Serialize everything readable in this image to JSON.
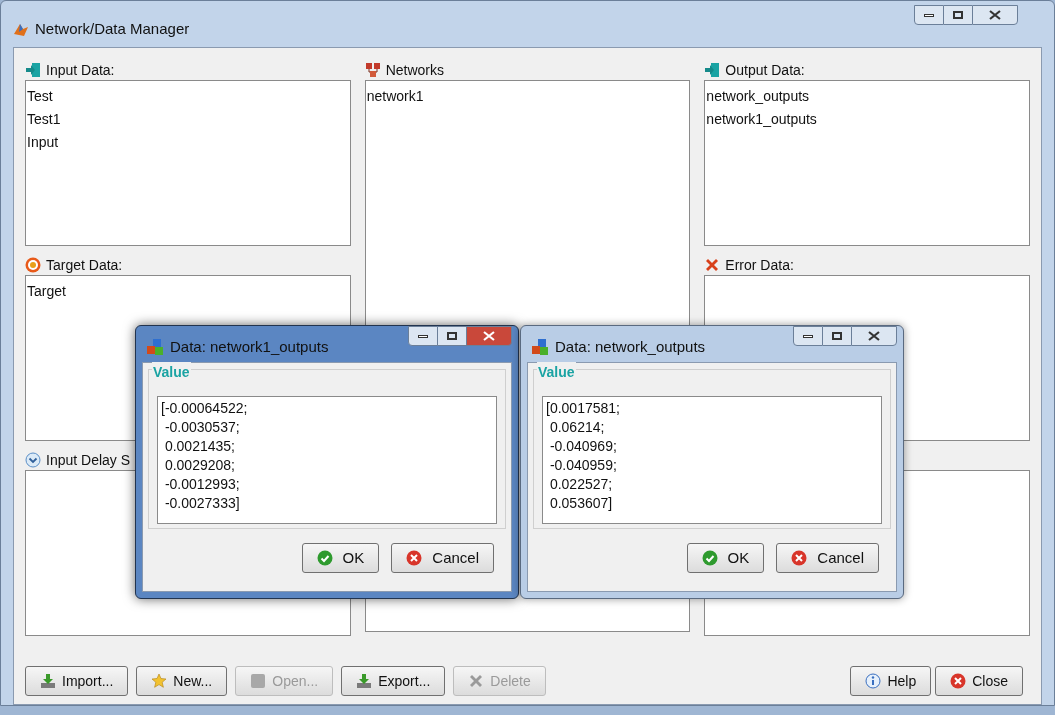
{
  "window": {
    "title": "Network/Data Manager"
  },
  "columns": [
    [
      {
        "label": "Input Data:",
        "kind": "input",
        "items": [
          "Test",
          "Test1",
          "Input"
        ]
      },
      {
        "label": "Target Data:",
        "kind": "target",
        "items": [
          "Target"
        ]
      },
      {
        "label": "Input Delay S",
        "kind": "delay"
      }
    ],
    [
      {
        "label": "Networks",
        "kind": "network",
        "items": [
          "network1"
        ]
      }
    ],
    [
      {
        "label": "Output Data:",
        "kind": "output",
        "items": [
          "network_outputs",
          "network1_outputs"
        ]
      },
      {
        "label": "Error Data:",
        "kind": "error"
      },
      {
        "kind": "plain"
      }
    ]
  ],
  "buttons_left": [
    {
      "label": "Import...",
      "kind": "import",
      "disabled": false
    },
    {
      "label": "New...",
      "kind": "new",
      "disabled": false
    },
    {
      "label": "Open...",
      "kind": "open",
      "disabled": true
    },
    {
      "label": "Export...",
      "kind": "export",
      "disabled": false
    },
    {
      "label": "Delete",
      "kind": "delete",
      "disabled": true
    }
  ],
  "buttons_right": [
    {
      "label": "Help",
      "kind": "help",
      "disabled": false
    },
    {
      "label": "Close",
      "kind": "close",
      "disabled": false
    }
  ],
  "dialogs": [
    {
      "title": "Data: network1_outputs",
      "active": true,
      "group_label": "Value",
      "value_lines": [
        "[-0.00064522;",
        " -0.0030537;",
        " 0.0021435;",
        " 0.0029208;",
        " -0.0012993;",
        " -0.0027333]"
      ],
      "buttons": [
        {
          "label": "OK",
          "kind": "ok"
        },
        {
          "label": "Cancel",
          "kind": "cancel"
        }
      ]
    },
    {
      "title": "Data: network_outputs",
      "active": false,
      "group_label": "Value",
      "value_lines": [
        "[0.0017581;",
        " 0.06214;",
        " -0.040969;",
        " -0.040959;",
        " 0.022527;",
        " 0.053607]"
      ],
      "buttons": [
        {
          "label": "OK",
          "kind": "ok"
        },
        {
          "label": "Cancel",
          "kind": "cancel"
        }
      ]
    }
  ]
}
